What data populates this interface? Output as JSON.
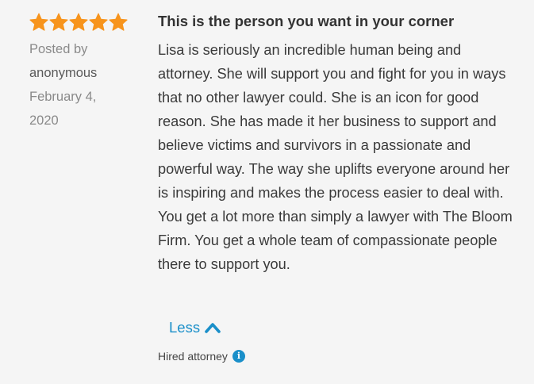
{
  "review": {
    "rating": 5,
    "rating_max": 5,
    "star_color": "#f7941d",
    "posted_by_label": "Posted by",
    "author": "anonymous",
    "date_line1": "February 4,",
    "date_line2": "2020",
    "title": "This is the person you want in your corner",
    "body": "Lisa is seriously an incredible human being and attorney. She will support you and fight for you in ways that no other lawyer could. She is an icon for good reason. She has made it her business to support and believe victims and survivors in a passionate and powerful way. The way she uplifts everyone around her is inspiring and makes the process easier to deal with. You get a lot more than simply a lawyer with The Bloom Firm. You get a whole team of compassionate people there to support you.",
    "less_label": "Less",
    "less_icon": "chevron-up-icon",
    "hired_label": "Hired attorney",
    "info_icon": "info-icon",
    "link_color": "#1a8fc9"
  }
}
